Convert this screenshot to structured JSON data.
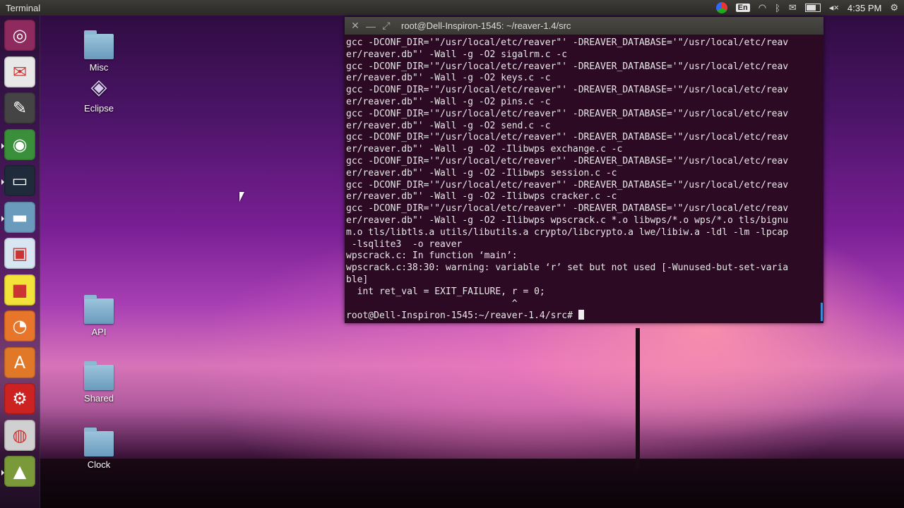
{
  "top_panel": {
    "title": "Terminal",
    "keyboard_layout": "En",
    "clock": "4:35 PM"
  },
  "launcher": {
    "items": [
      {
        "name": "ubuntu-home-icon",
        "color": "#8e2a5e",
        "glyph": "◎"
      },
      {
        "name": "mail-client-icon",
        "color": "#e8e8e8",
        "glyph": "✉"
      },
      {
        "name": "text-editor-icon",
        "color": "#444444",
        "glyph": "✎"
      },
      {
        "name": "chrome-browser-icon",
        "color": "#3a8f3a",
        "glyph": "◉"
      },
      {
        "name": "terminal-icon",
        "color": "#1f2a3a",
        "glyph": "▭"
      },
      {
        "name": "files-folder-icon",
        "color": "#6a9bbd",
        "glyph": "▬"
      },
      {
        "name": "image-viewer-icon",
        "color": "#d8e6f2",
        "glyph": "▣"
      },
      {
        "name": "sticky-notes-icon",
        "color": "#f2e23a",
        "glyph": "■"
      },
      {
        "name": "firefox-icon",
        "color": "#e8762a",
        "glyph": "◔"
      },
      {
        "name": "software-center-icon",
        "color": "#e07828",
        "glyph": "A"
      },
      {
        "name": "system-settings-icon",
        "color": "#cc2222",
        "glyph": "⚙"
      },
      {
        "name": "speaker-app-icon",
        "color": "#d0d0d0",
        "glyph": "◍"
      },
      {
        "name": "android-app-icon",
        "color": "#7a9a3a",
        "glyph": "▲"
      }
    ]
  },
  "desktop_icons": [
    {
      "label": "Misc"
    },
    {
      "label": "Eclipse"
    },
    {
      "label": "API"
    },
    {
      "label": "Shared"
    },
    {
      "label": "Clock"
    }
  ],
  "terminal": {
    "window_title": "root@Dell-Inspiron-1545: ~/reaver-1.4/src",
    "lines": [
      "gcc -DCONF_DIR='\"/usr/local/etc/reaver\"' -DREAVER_DATABASE='\"/usr/local/etc/reav",
      "er/reaver.db\"' -Wall -g -O2 sigalrm.c -c",
      "gcc -DCONF_DIR='\"/usr/local/etc/reaver\"' -DREAVER_DATABASE='\"/usr/local/etc/reav",
      "er/reaver.db\"' -Wall -g -O2 keys.c -c",
      "gcc -DCONF_DIR='\"/usr/local/etc/reaver\"' -DREAVER_DATABASE='\"/usr/local/etc/reav",
      "er/reaver.db\"' -Wall -g -O2 pins.c -c",
      "gcc -DCONF_DIR='\"/usr/local/etc/reaver\"' -DREAVER_DATABASE='\"/usr/local/etc/reav",
      "er/reaver.db\"' -Wall -g -O2 send.c -c",
      "gcc -DCONF_DIR='\"/usr/local/etc/reaver\"' -DREAVER_DATABASE='\"/usr/local/etc/reav",
      "er/reaver.db\"' -Wall -g -O2 -Ilibwps exchange.c -c",
      "gcc -DCONF_DIR='\"/usr/local/etc/reaver\"' -DREAVER_DATABASE='\"/usr/local/etc/reav",
      "er/reaver.db\"' -Wall -g -O2 -Ilibwps session.c -c",
      "gcc -DCONF_DIR='\"/usr/local/etc/reaver\"' -DREAVER_DATABASE='\"/usr/local/etc/reav",
      "er/reaver.db\"' -Wall -g -O2 -Ilibwps cracker.c -c",
      "gcc -DCONF_DIR='\"/usr/local/etc/reaver\"' -DREAVER_DATABASE='\"/usr/local/etc/reav",
      "er/reaver.db\"' -Wall -g -O2 -Ilibwps wpscrack.c *.o libwps/*.o wps/*.o tls/bignu",
      "m.o tls/libtls.a utils/libutils.a crypto/libcrypto.a lwe/libiw.a -ldl -lm -lpcap",
      " -lsqlite3  -o reaver",
      "wpscrack.c: In function ‘main’:",
      "wpscrack.c:38:30: warning: variable ‘r’ set but not used [-Wunused-but-set-varia",
      "ble]",
      "  int ret_val = EXIT_FAILURE, r = 0;",
      "                              ^"
    ],
    "prompt": "root@Dell-Inspiron-1545:~/reaver-1.4/src# "
  }
}
